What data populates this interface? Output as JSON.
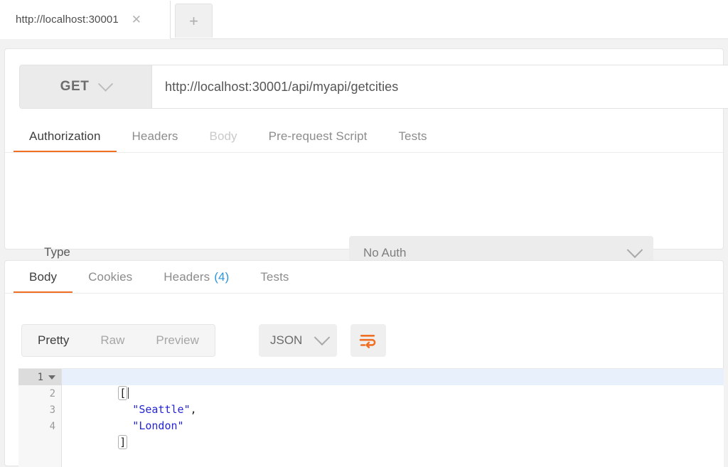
{
  "tabstrip": {
    "active_tab_label": "http://localhost:30001",
    "close_icon": "close-icon",
    "new_tab_label": "+"
  },
  "request": {
    "method": "GET",
    "method_caret": "chevron-down-icon",
    "url": "http://localhost:30001/api/myapi/getcities",
    "tabs": [
      {
        "label": "Authorization",
        "state": "active"
      },
      {
        "label": "Headers",
        "state": "normal"
      },
      {
        "label": "Body",
        "state": "dim"
      },
      {
        "label": "Pre-request Script",
        "state": "normal"
      },
      {
        "label": "Tests",
        "state": "normal"
      }
    ],
    "auth": {
      "type_label": "Type",
      "type_value": "No Auth"
    }
  },
  "response": {
    "tabs": [
      {
        "label": "Body",
        "state": "active",
        "count": ""
      },
      {
        "label": "Cookies",
        "state": "normal",
        "count": ""
      },
      {
        "label": "Headers",
        "state": "normal",
        "count": "(4)"
      },
      {
        "label": "Tests",
        "state": "normal",
        "count": ""
      }
    ],
    "view_modes": [
      {
        "label": "Pretty",
        "state": "active"
      },
      {
        "label": "Raw",
        "state": "normal"
      },
      {
        "label": "Preview",
        "state": "normal"
      }
    ],
    "format": "JSON",
    "wrap_icon": "wrap-text-icon",
    "editor": {
      "lines": [
        {
          "number": "1",
          "foldable": true,
          "active": true,
          "text": "[",
          "kind": "punct"
        },
        {
          "number": "2",
          "foldable": false,
          "active": false,
          "text": "  \"Seattle\",",
          "kind": "string"
        },
        {
          "number": "3",
          "foldable": false,
          "active": false,
          "text": "  \"London\"",
          "kind": "string"
        },
        {
          "number": "4",
          "foldable": false,
          "active": false,
          "text": "]",
          "kind": "punct"
        }
      ],
      "content_values": [
        "Seattle",
        "London"
      ]
    }
  },
  "colors": {
    "accent": "#f06f24",
    "link": "#2f96dd",
    "string": "#2525d7",
    "active_line": "#e8f0fb"
  }
}
